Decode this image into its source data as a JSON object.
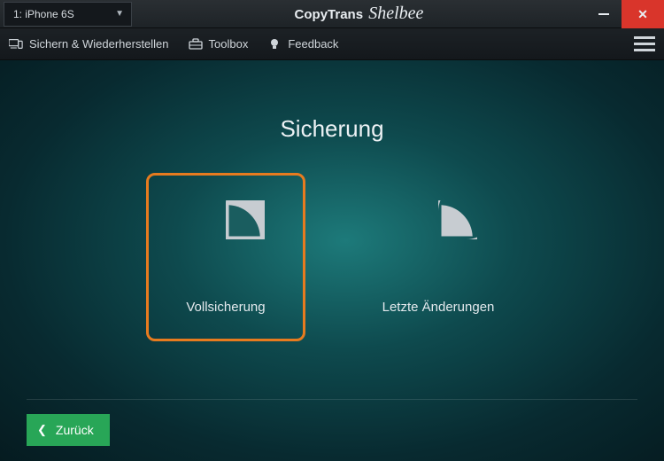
{
  "titlebar": {
    "device_selected": "1: iPhone 6S",
    "app_name_bold": "CopyTrans",
    "app_name_script": "Shelbee"
  },
  "menu": {
    "backup_restore": "Sichern & Wiederherstellen",
    "toolbox": "Toolbox",
    "feedback": "Feedback"
  },
  "main": {
    "title": "Sicherung",
    "option_full": "Vollsicherung",
    "option_latest": "Letzte Änderungen"
  },
  "footer": {
    "back": "Zurück"
  },
  "colors": {
    "accent_orange": "#e77b1f",
    "accent_green": "#28a657",
    "close_red": "#d9352b"
  }
}
